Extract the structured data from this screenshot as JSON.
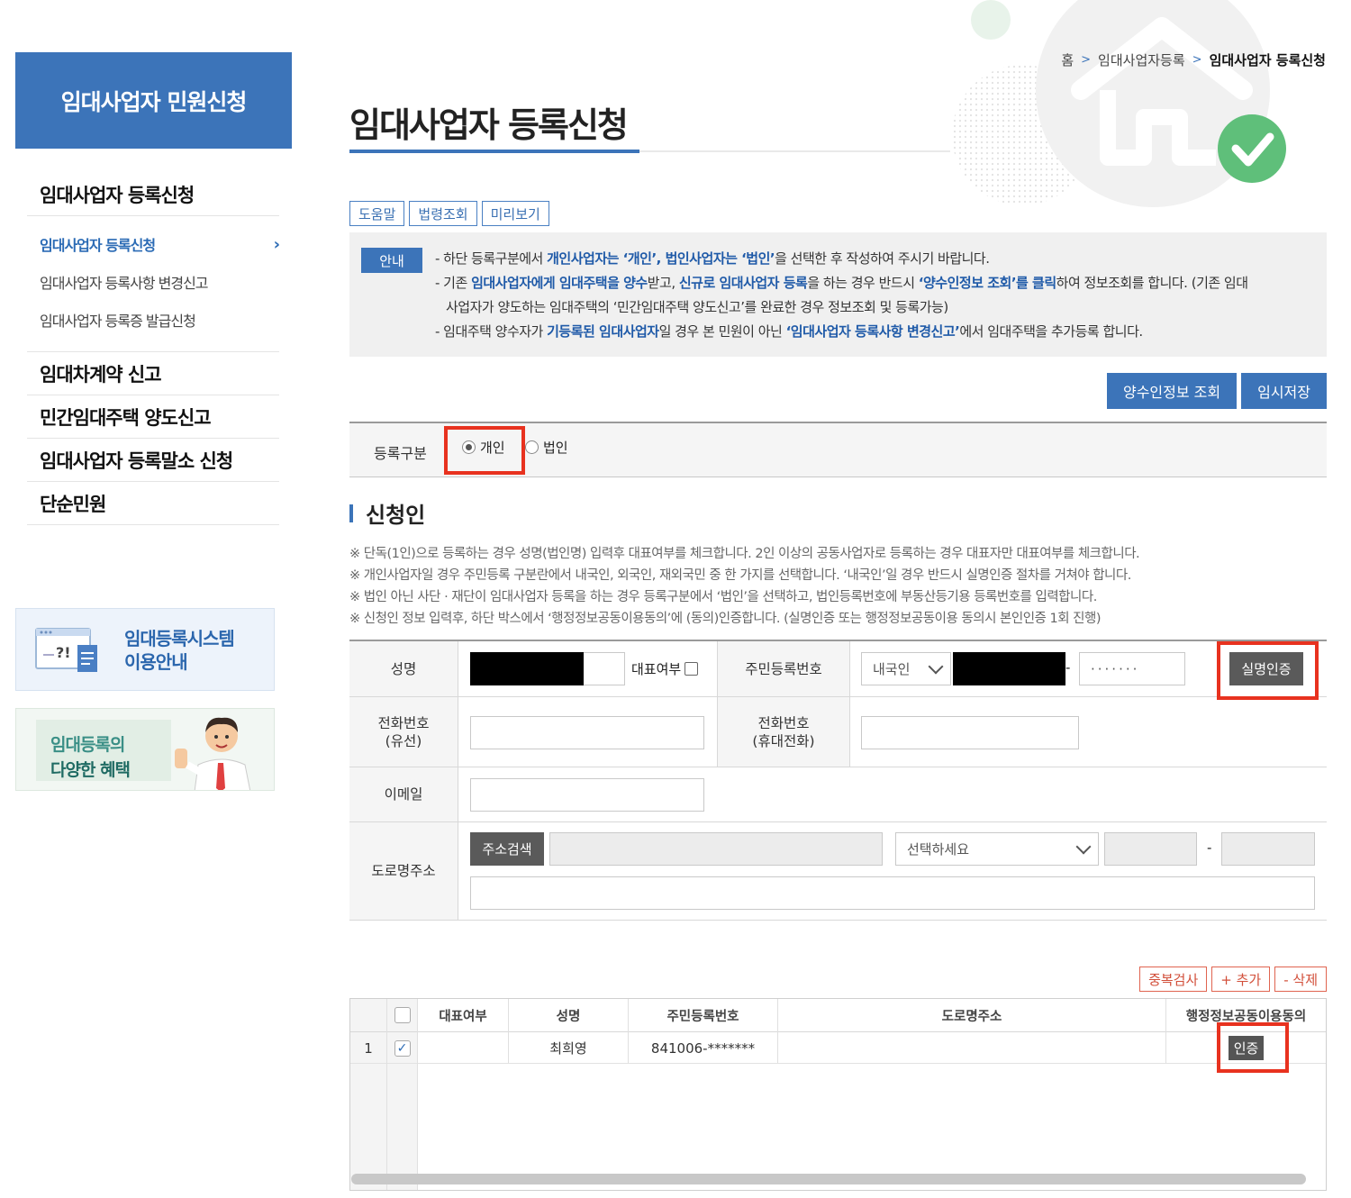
{
  "sidebar": {
    "header": "임대사업자 민원신청",
    "menu_main1": "임대사업자 등록신청",
    "sub_items": [
      "임대사업자 등록신청",
      "임대사업자 등록사항 변경신고",
      "임대사업자 등록증 발급신청"
    ],
    "menu_main2": "임대차계약 신고",
    "menu_main3": "민간임대주택 양도신고",
    "menu_main4": "임대사업자 등록말소 신청",
    "menu_main5": "단순민원",
    "banner1_line1": "임대등록시스템",
    "banner1_line2": "이용안내",
    "banner2_line1": "임대등록의",
    "banner2_line2": "다양한 혜택"
  },
  "breadcrumb": {
    "home": "홈",
    "level1": "임대사업자등록",
    "current": "임대사업자 등록신청"
  },
  "page_title": "임대사업자 등록신청",
  "toolbar": {
    "help": "도움말",
    "law": "법령조회",
    "preview": "미리보기"
  },
  "notice": {
    "tag": "안내",
    "l1a": "- 하단 등록구분에서 ",
    "l1b": "개인사업자는 ‘개인’, 법인사업자는 ‘법인’",
    "l1c": "을 선택한 후 작성하여 주시기 바랍니다.",
    "l2a": "- 기존 ",
    "l2b": "임대사업자에게 임대주택을 양수",
    "l2c": "받고, ",
    "l2d": "신규로 임대사업자 등록",
    "l2e": "을 하는 경우 반드시 ",
    "l2f": "‘양수인정보 조회’를 클릭",
    "l2g": "하여 정보조회를 합니다. (기존 임대",
    "l3": "사업자가 양도하는 임대주택의 ‘민간임대주택 양도신고’를 완료한 경우 정보조회 및 등록가능)",
    "l4a": "- 임대주택 양수자가 ",
    "l4b": "기등록된 임대사업자",
    "l4c": "일 경우 본 민원이 아닌 ",
    "l4d": "‘임대사업자 등록사항 변경신고’",
    "l4e": "에서 임대주택을 추가등록 합니다."
  },
  "actions": {
    "transferee_lookup": "양수인정보 조회",
    "temp_save": "임시저장"
  },
  "registration": {
    "label": "등록구분",
    "opt_individual": "개인",
    "opt_corporate": "법인",
    "selected": "개인"
  },
  "applicant": {
    "section_title": "신청인",
    "notes": [
      "※ 단독(1인)으로 등록하는 경우 성명(법인명) 입력후 대표여부를 체크합니다. 2인 이상의 공동사업자로 등록하는 경우 대표자만 대표여부를 체크합니다.",
      "※ 개인사업자일 경우 주민등록 구분란에서 내국인, 외국인, 재외국민 중 한 가지를 선택합니다. ‘내국인’일 경우 반드시 실명인증 절차를 거쳐야 합니다.",
      "※ 법인 아닌 사단 · 재단이 임대사업자 등록을 하는 경우 등록구분에서 ‘법인’을 선택하고, 법인등록번호에 부동산등기용 등록번호를 입력합니다.",
      "※ 신청인 정보 입력후, 하단 박스에서 ‘행정정보공동이용동의’에 (동의)인증합니다. (실명인증 또는 행정정보공동이용 동의시 본인인증 1회 진행)"
    ],
    "name_label": "성명",
    "rep_label": "대표여부",
    "rrn_label": "주민등록번호",
    "rrn_type": "내국인",
    "rrn_dash": "-",
    "rrn_masked": "·······",
    "verify_button": "실명인증",
    "phone_label_1": "전화번호",
    "phone_label_1b": "(유선)",
    "mobile_label_1": "전화번호",
    "mobile_label_1b": "(휴대전화)",
    "email_label": "이메일",
    "address_label": "도로명주소",
    "address_search": "주소검색",
    "address_select": "선택하세요",
    "address_dash": "-"
  },
  "list": {
    "btn_dup": "중복검사",
    "btn_add": "+ 추가",
    "btn_del": "- 삭제",
    "columns": [
      "대표여부",
      "성명",
      "주민등록번호",
      "도로명주소",
      "행정정보공동이용동의"
    ],
    "rows": [
      {
        "no": "1",
        "checked": true,
        "rep": "",
        "name": "최희영",
        "rrn": "841006-*******",
        "address": "",
        "consent": "인증"
      }
    ]
  },
  "colors": {
    "accent": "#3c74b9",
    "highlight_box": "#e8321f",
    "list_button": "#d24f3a"
  }
}
